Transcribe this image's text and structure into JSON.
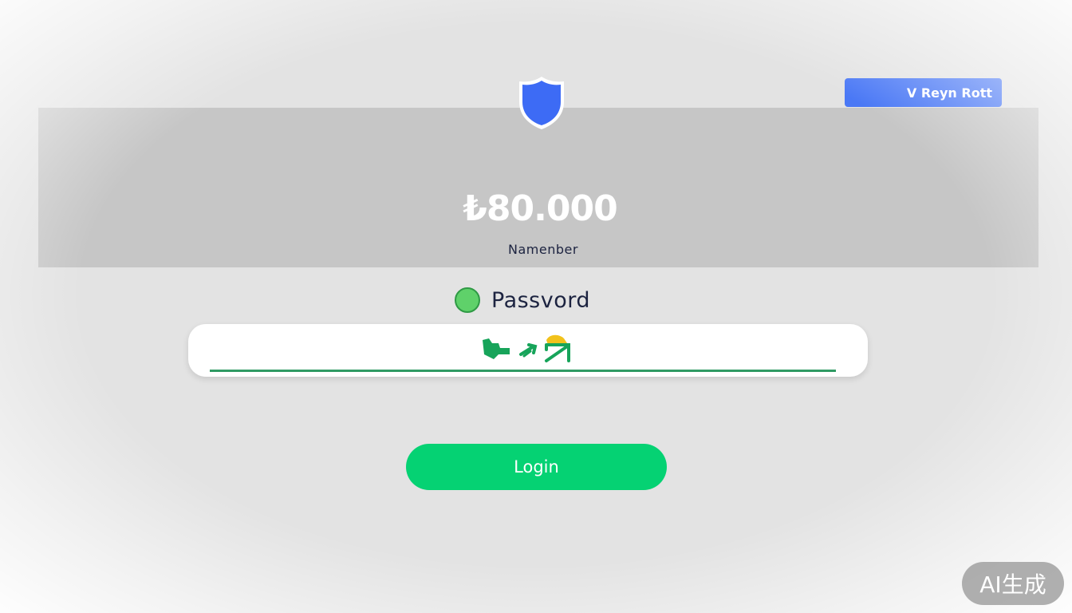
{
  "header": {
    "top_button_label": "V Reyn Rott"
  },
  "hero": {
    "amount": "₺80.000",
    "member_label": "Namenber"
  },
  "password": {
    "label": "Passvord"
  },
  "actions": {
    "login_label": "Login"
  },
  "watermark": {
    "text": "AI生成"
  },
  "colors": {
    "background": "#e3e3e3",
    "hero_band": "#c6c6c6",
    "shield_blue": "#3d6bf5",
    "top_button": "#4a78f5",
    "login_green": "#05d273",
    "status_green": "#5fd16a",
    "underline_green": "#2f9a63",
    "text_dark": "#1c2340"
  },
  "icons": {
    "shield": "shield-icon",
    "status": "status-dot-icon",
    "field_glyphs": "password-glyphs-icon"
  }
}
